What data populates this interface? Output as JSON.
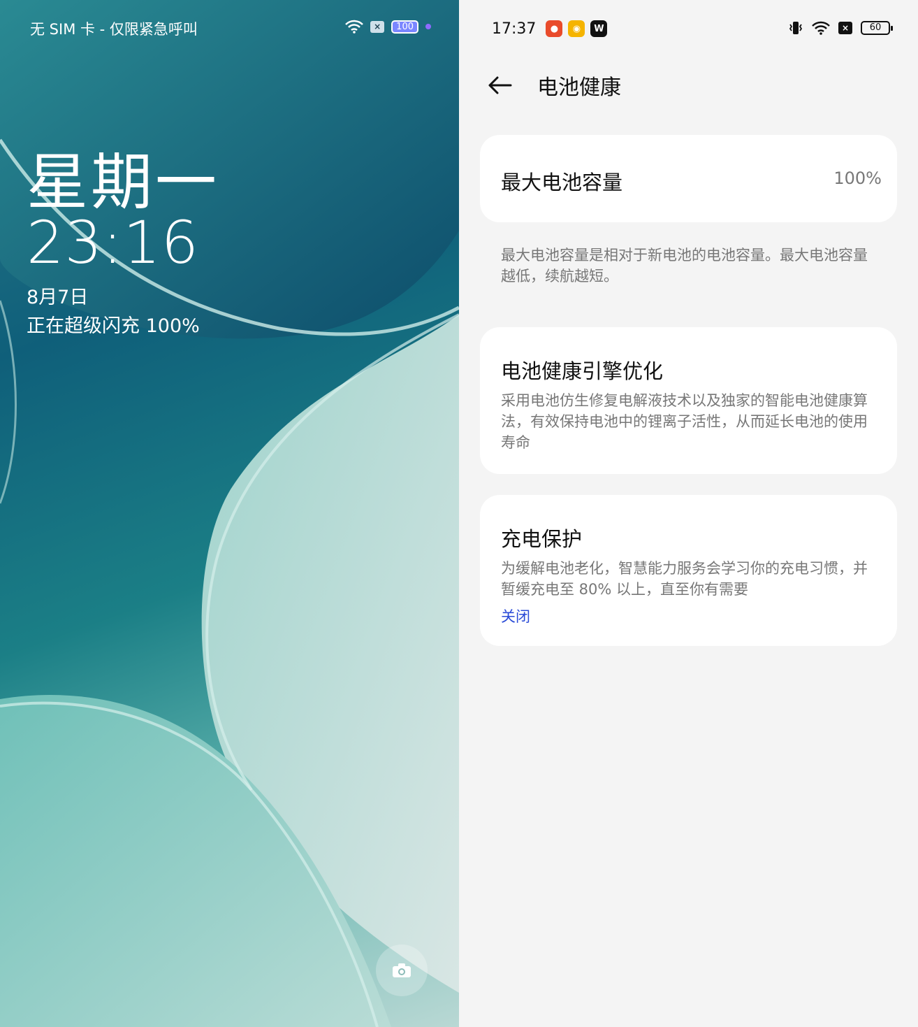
{
  "lock_screen": {
    "carrier_text": "无 SIM 卡 - 仅限紧急呼叫",
    "battery_level": "100",
    "weekday": "星期一",
    "time": "23:16",
    "date": "8月7日",
    "charging_status": "正在超级闪充 100%",
    "icons": [
      "wifi-icon",
      "sim-off-icon",
      "battery-icon",
      "camera-icon"
    ]
  },
  "settings": {
    "status_time": "17:37",
    "status_app_icons": [
      "red-app-icon",
      "weibo-icon",
      "wps-icon"
    ],
    "battery_level": "60",
    "page_title": "电池健康",
    "max_capacity": {
      "label": "最大电池容量",
      "value": "100%"
    },
    "capacity_note": "最大电池容量是相对于新电池的电池容量。最大电池容量越低，续航越短。",
    "engine": {
      "title": "电池健康引擎优化",
      "description": "采用电池仿生修复电解液技术以及独家的智能电池健康算法，有效保持电池中的锂离子活性，从而延长电池的使用寿命"
    },
    "charge_protection": {
      "title": "充电保护",
      "description": "为缓解电池老化，智慧能力服务会学习你的充电习惯，并暂缓充电至 80% 以上，直至你有需要",
      "status": "关闭"
    },
    "accent_color": "#2a4bd7"
  }
}
